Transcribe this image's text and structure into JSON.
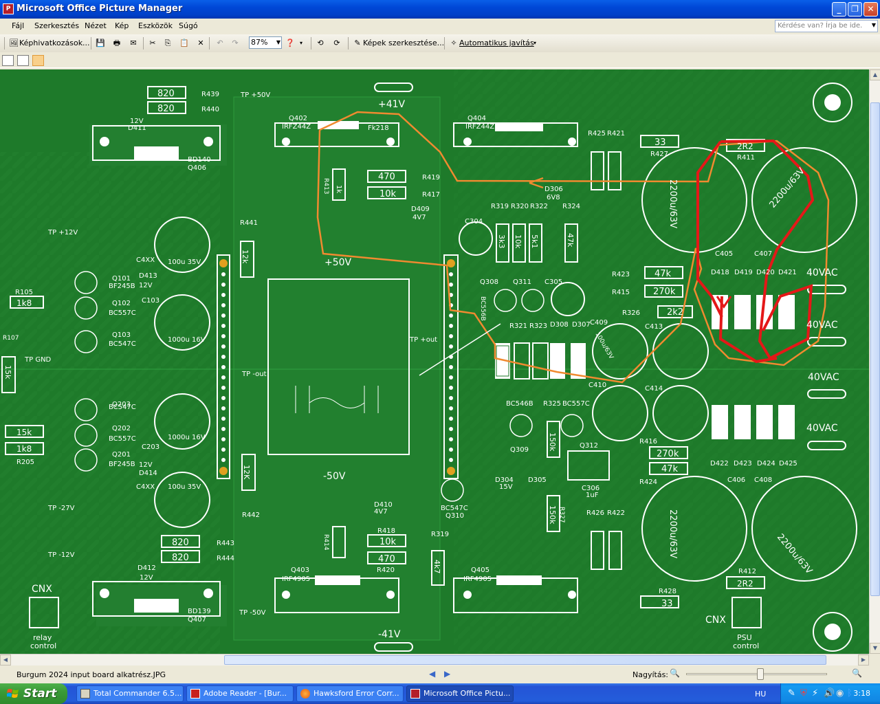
{
  "window": {
    "title": "Microsoft Office Picture Manager",
    "app_icon": "picture-manager-icon"
  },
  "menu": [
    "Fájl",
    "Szerkesztés",
    "Nézet",
    "Kép",
    "Eszközök",
    "Súgó"
  ],
  "help_box": {
    "placeholder": "Kérdése van? Írja be ide."
  },
  "toolbar": {
    "shortcuts_label": "Képhivatkozások...",
    "zoom_value": "87%",
    "edit_label": "Képek szerkesztése...",
    "auto_label": "Automatikus javítás"
  },
  "pcb": {
    "labels": {
      "p41": "+41V",
      "m41": "-41V",
      "p50": "+50V",
      "m50": "-50V",
      "vac1": "40VAC",
      "vac2": "40VAC",
      "vac3": "40VAC",
      "vac4": "40VAC",
      "cnx1": "CNX",
      "cnx2": "CNX",
      "relay": "relay",
      "control1": "control",
      "psu": "PSU",
      "control2": "control",
      "tp50": "TP +50V",
      "tpm50": "TP -50V",
      "tp12": "TP +12V",
      "tpm12": "TP -12V",
      "tpgnd": "TP GND",
      "tpout": "TP +out",
      "tpmout": "TP -out",
      "tpm27": "TP -27V",
      "r439": "R439",
      "r440": "R440",
      "r820a": "820",
      "r820b": "820",
      "r820c": "820",
      "r820d": "820",
      "r443": "R443",
      "r444": "R444",
      "q402": "Q402",
      "irfz44z": "IRFZ44Z",
      "q404": "Q404",
      "irfz44z2": "IRFZ44Z",
      "q403": "Q403",
      "irf4905": "IRF4905",
      "q405": "Q405",
      "irf4905b": "IRF4905",
      "bd140": "BD140",
      "q406": "Q406",
      "bd139": "BD139",
      "q407": "Q407",
      "r419": "R419",
      "r417": "R417",
      "v470a": "470",
      "v10ka": "10k",
      "d409": "D409",
      "v4v7a": "4V7",
      "r413": "R413",
      "v1k": "1k",
      "r418": "R418",
      "r420": "R420",
      "v10kb": "10k",
      "v470b": "470",
      "d410": "D410",
      "v4v7b": "4V7",
      "r414": "R414",
      "r427": "R427",
      "v33a": "33",
      "r425": "R425",
      "r421": "R421",
      "r411": "R411",
      "v2r2a": "2R2",
      "r428": "R428",
      "v33b": "33",
      "r412": "R412",
      "v2r2b": "2R2",
      "r426": "R426",
      "r422": "R422",
      "c2200a": "2200u/63V",
      "c2200b": "2200u/63V",
      "c2200c": "2200u/63V",
      "c2200d": "2200u/63V",
      "c405": "C405",
      "c407": "C407",
      "c406": "C406",
      "c408": "C408",
      "d418": "D418",
      "d419": "D419",
      "d420": "D420",
      "d421": "D421",
      "d422": "D422",
      "d423": "D423",
      "d424": "D424",
      "d425": "D425",
      "r423": "R423",
      "v47ka": "47k",
      "r415": "R415",
      "v270ka": "270k",
      "r326": "R326",
      "v2k2": "2k2",
      "r416": "R416",
      "v270kb": "270k",
      "v47kb": "47k",
      "r424": "R424",
      "c409": "C409",
      "c413": "C413",
      "c410": "C410",
      "c414": "C414",
      "c100u63": "100u/63V",
      "r319": "R319",
      "r320": "R320",
      "r322": "R322",
      "r324": "R324",
      "v3k3": "3k3",
      "v10kc": "10k",
      "v5k1": "5k1",
      "v47kc": "47k",
      "c304": "C304",
      "q308": "Q308",
      "q311": "Q311",
      "c305": "C305",
      "bc556b": "BC556B",
      "r321": "R321",
      "r323": "R323",
      "d308": "D308",
      "d307": "D307",
      "d306": "D306",
      "v6v8": "6V8",
      "bc546b": "BC546B",
      "r325": "R325",
      "bc557c": "BC557C",
      "q309": "Q309",
      "q312": "Q312",
      "c306": "C306",
      "v1uf": "1uF",
      "d304": "D304",
      "v15v": "15V",
      "d305": "D305",
      "r327": "R327",
      "v150k": "150k",
      "v150kb": "150k",
      "q310": "Q310",
      "bc547c": "BC547C",
      "r319b": "R319",
      "v4k7": "4k7",
      "r441": "R441",
      "v12k": "12k",
      "r442": "R442",
      "v12kb": "12K",
      "r105": "R105",
      "v1k8": "1k8",
      "r107": "R107",
      "v15k": "15k",
      "r205": "R205",
      "v15kb": "15k",
      "v1k8b": "1k8",
      "q101": "Q101",
      "bf245b": "BF245B",
      "q102": "Q102",
      "bc557ca": "BC557C",
      "q103": "Q103",
      "bc547ca": "BC547C",
      "q203": "Q203",
      "bc547cb": "BC547C",
      "q202": "Q202",
      "bc557cb": "BC557C",
      "q201": "Q201",
      "bf245bb": "BF245B",
      "d413": "D413",
      "v12va": "12V",
      "d414": "D414",
      "v12vb": "12V",
      "d411": "D411",
      "v12vc": "12V",
      "d412": "D412",
      "v12vd": "12V",
      "c103": "C103",
      "c203": "C203",
      "c4xx": "C4XX",
      "c4xxb": "C4XX",
      "c1000u": "1000u 16V",
      "c1000ub": "1000u 16V",
      "c100u35": "100u 35V",
      "c100u35b": "100u 35V",
      "fk218": "Fk218"
    }
  },
  "status": {
    "filename": "Burgum 2024 input board alkatrész.JPG",
    "zoom_label": "Nagyítás:"
  },
  "taskbar": {
    "start": "Start",
    "tasks": [
      "Total Commander 6.5...",
      "Adobe Reader - [Bur...",
      "Hawksford Error Corr...",
      "Microsoft Office Pictu..."
    ],
    "lang": "HU",
    "clock": "3:18"
  }
}
